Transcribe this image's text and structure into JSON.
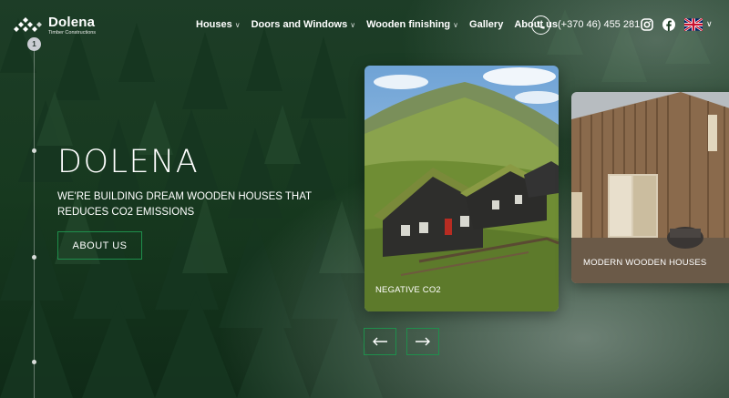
{
  "brand": {
    "name": "Dolena",
    "subtitle": "Timber Constructions"
  },
  "nav": {
    "items": [
      {
        "label": "Houses",
        "dropdown": true
      },
      {
        "label": "Doors and Windows",
        "dropdown": true
      },
      {
        "label": "Wooden finishing",
        "dropdown": true
      },
      {
        "label": "Gallery",
        "dropdown": false
      },
      {
        "label": "About us",
        "dropdown": false
      }
    ],
    "phone": "(+370 46) 455 281",
    "social": [
      "instagram-icon",
      "facebook-icon"
    ],
    "language": "uk-flag-icon"
  },
  "pager": {
    "current": "1"
  },
  "hero": {
    "title": "DOLENA",
    "subtitle": "WE'RE BUILDING DREAM WOODEN HOUSES THAT REDUCES CO2 EMISSIONS",
    "button": "ABOUT US"
  },
  "slides": [
    {
      "label": "NEGATIVE CO2"
    },
    {
      "label": "MODERN WOODEN HOUSES"
    }
  ],
  "colors": {
    "accent": "#1f8f4c",
    "forest": "#0e2818"
  }
}
